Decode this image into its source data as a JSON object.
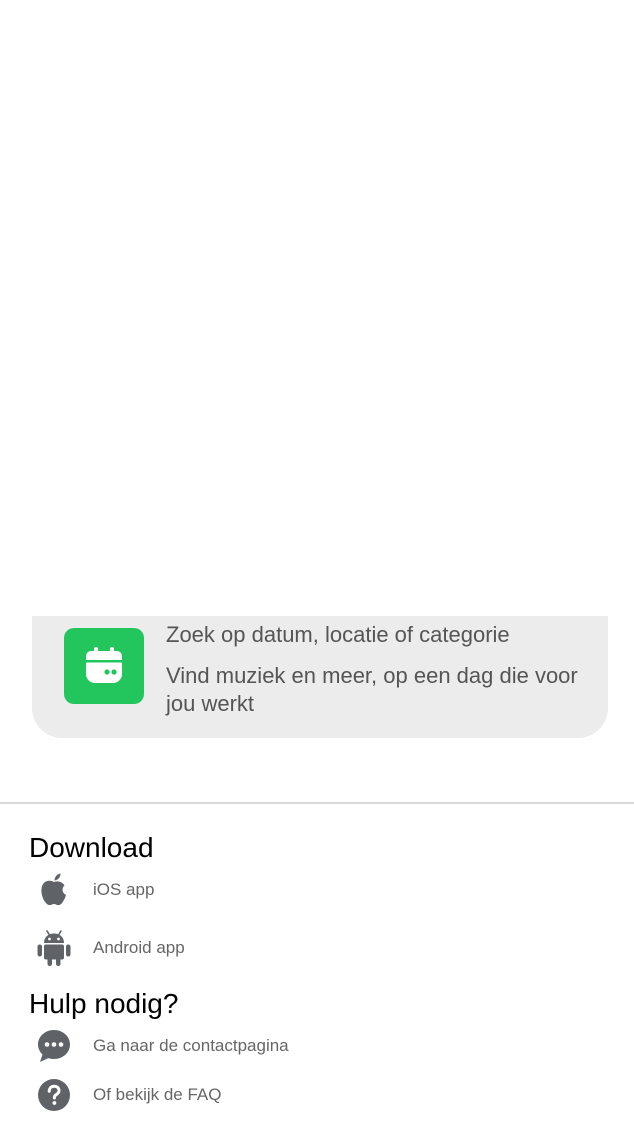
{
  "feature": {
    "title": "Zoek op datum, locatie of categorie",
    "description": "Vind muziek en meer, op een dag die voor jou werkt",
    "icon": "calendar-icon",
    "accent_color": "#22c65c",
    "card_color": "#ececec"
  },
  "footer": {
    "download": {
      "heading": "Download",
      "links": [
        {
          "label": "iOS app",
          "icon": "apple-icon"
        },
        {
          "label": "Android app",
          "icon": "android-icon"
        }
      ]
    },
    "help": {
      "heading": "Hulp nodig?",
      "links": [
        {
          "label": "Ga naar de contactpagina",
          "icon": "chat-icon"
        },
        {
          "label": "Of bekijk de FAQ",
          "icon": "question-icon"
        }
      ]
    },
    "icon_color": "#5f6368"
  }
}
